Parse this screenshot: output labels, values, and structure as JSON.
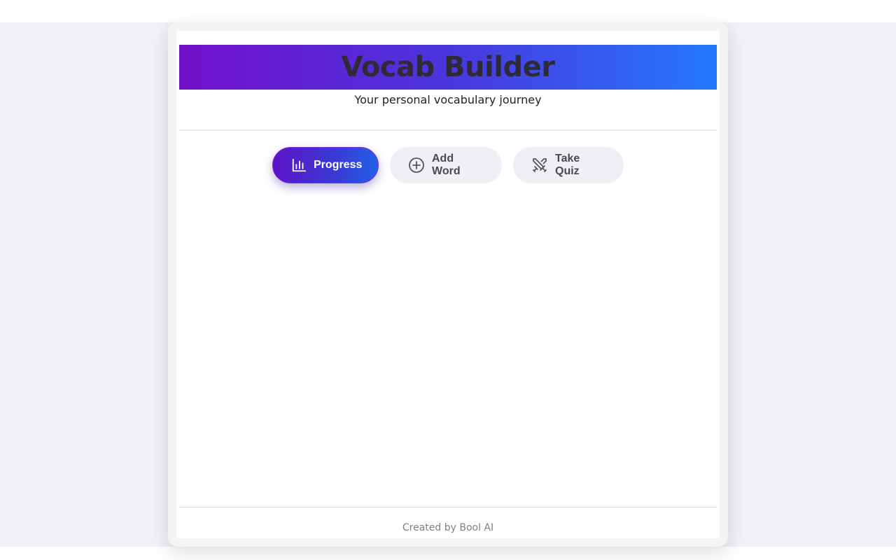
{
  "header": {
    "title": "Vocab Builder",
    "subtitle": "Your personal vocabulary journey"
  },
  "tabs": [
    {
      "label": "Progress",
      "icon": "bar-chart-icon",
      "active": true
    },
    {
      "label": "Add Word",
      "icon": "plus-circle-icon",
      "active": false
    },
    {
      "label": "Take Quiz",
      "icon": "swords-icon",
      "active": false
    }
  ],
  "footer": {
    "text": "Created by Bool AI"
  },
  "colors": {
    "gradient_start": "#7210c9",
    "gradient_end": "#2479fb",
    "inactive_tab_bg": "#eef0f5",
    "page_bg": "#f0f2f6"
  }
}
